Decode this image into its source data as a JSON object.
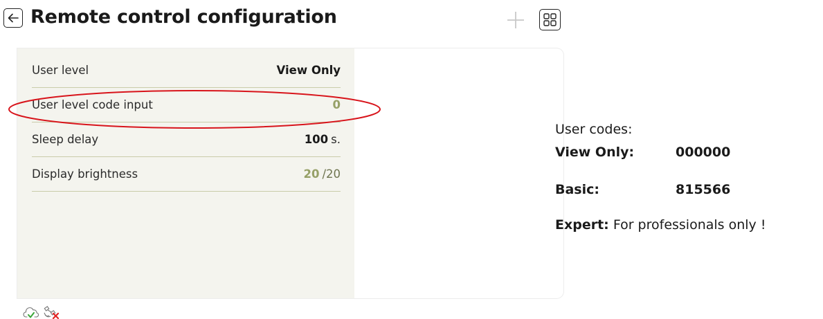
{
  "header": {
    "title": "Remote control configuration",
    "back_icon": "arrow-left-icon",
    "add_icon": "plus-icon",
    "layout_icon": "grid-icon"
  },
  "settings": [
    {
      "label": "User level",
      "value": "View Only",
      "unit": ""
    },
    {
      "label": "User level code input",
      "value": "0",
      "unit": ""
    },
    {
      "label": "Sleep delay",
      "value": "100",
      "unit": "s."
    },
    {
      "label": "Display brightness",
      "value": "20",
      "unit": "/20"
    }
  ],
  "notes": {
    "title": "User codes:",
    "lines": [
      {
        "key": "View Only:",
        "value": "000000"
      },
      {
        "key": "Basic:",
        "value": "815566"
      },
      {
        "key": "Expert:",
        "value": "For professionals only !"
      }
    ]
  },
  "footer": {
    "cloud_icon": "cloud-check-icon",
    "satellite_icon": "satellite-off-icon"
  },
  "colors": {
    "panel_background": "#f4f4ee",
    "accent": "#96a067",
    "divider": "#c9cca9",
    "highlight": "#d8141b",
    "ok": "#3aa537",
    "error": "#e32424"
  }
}
